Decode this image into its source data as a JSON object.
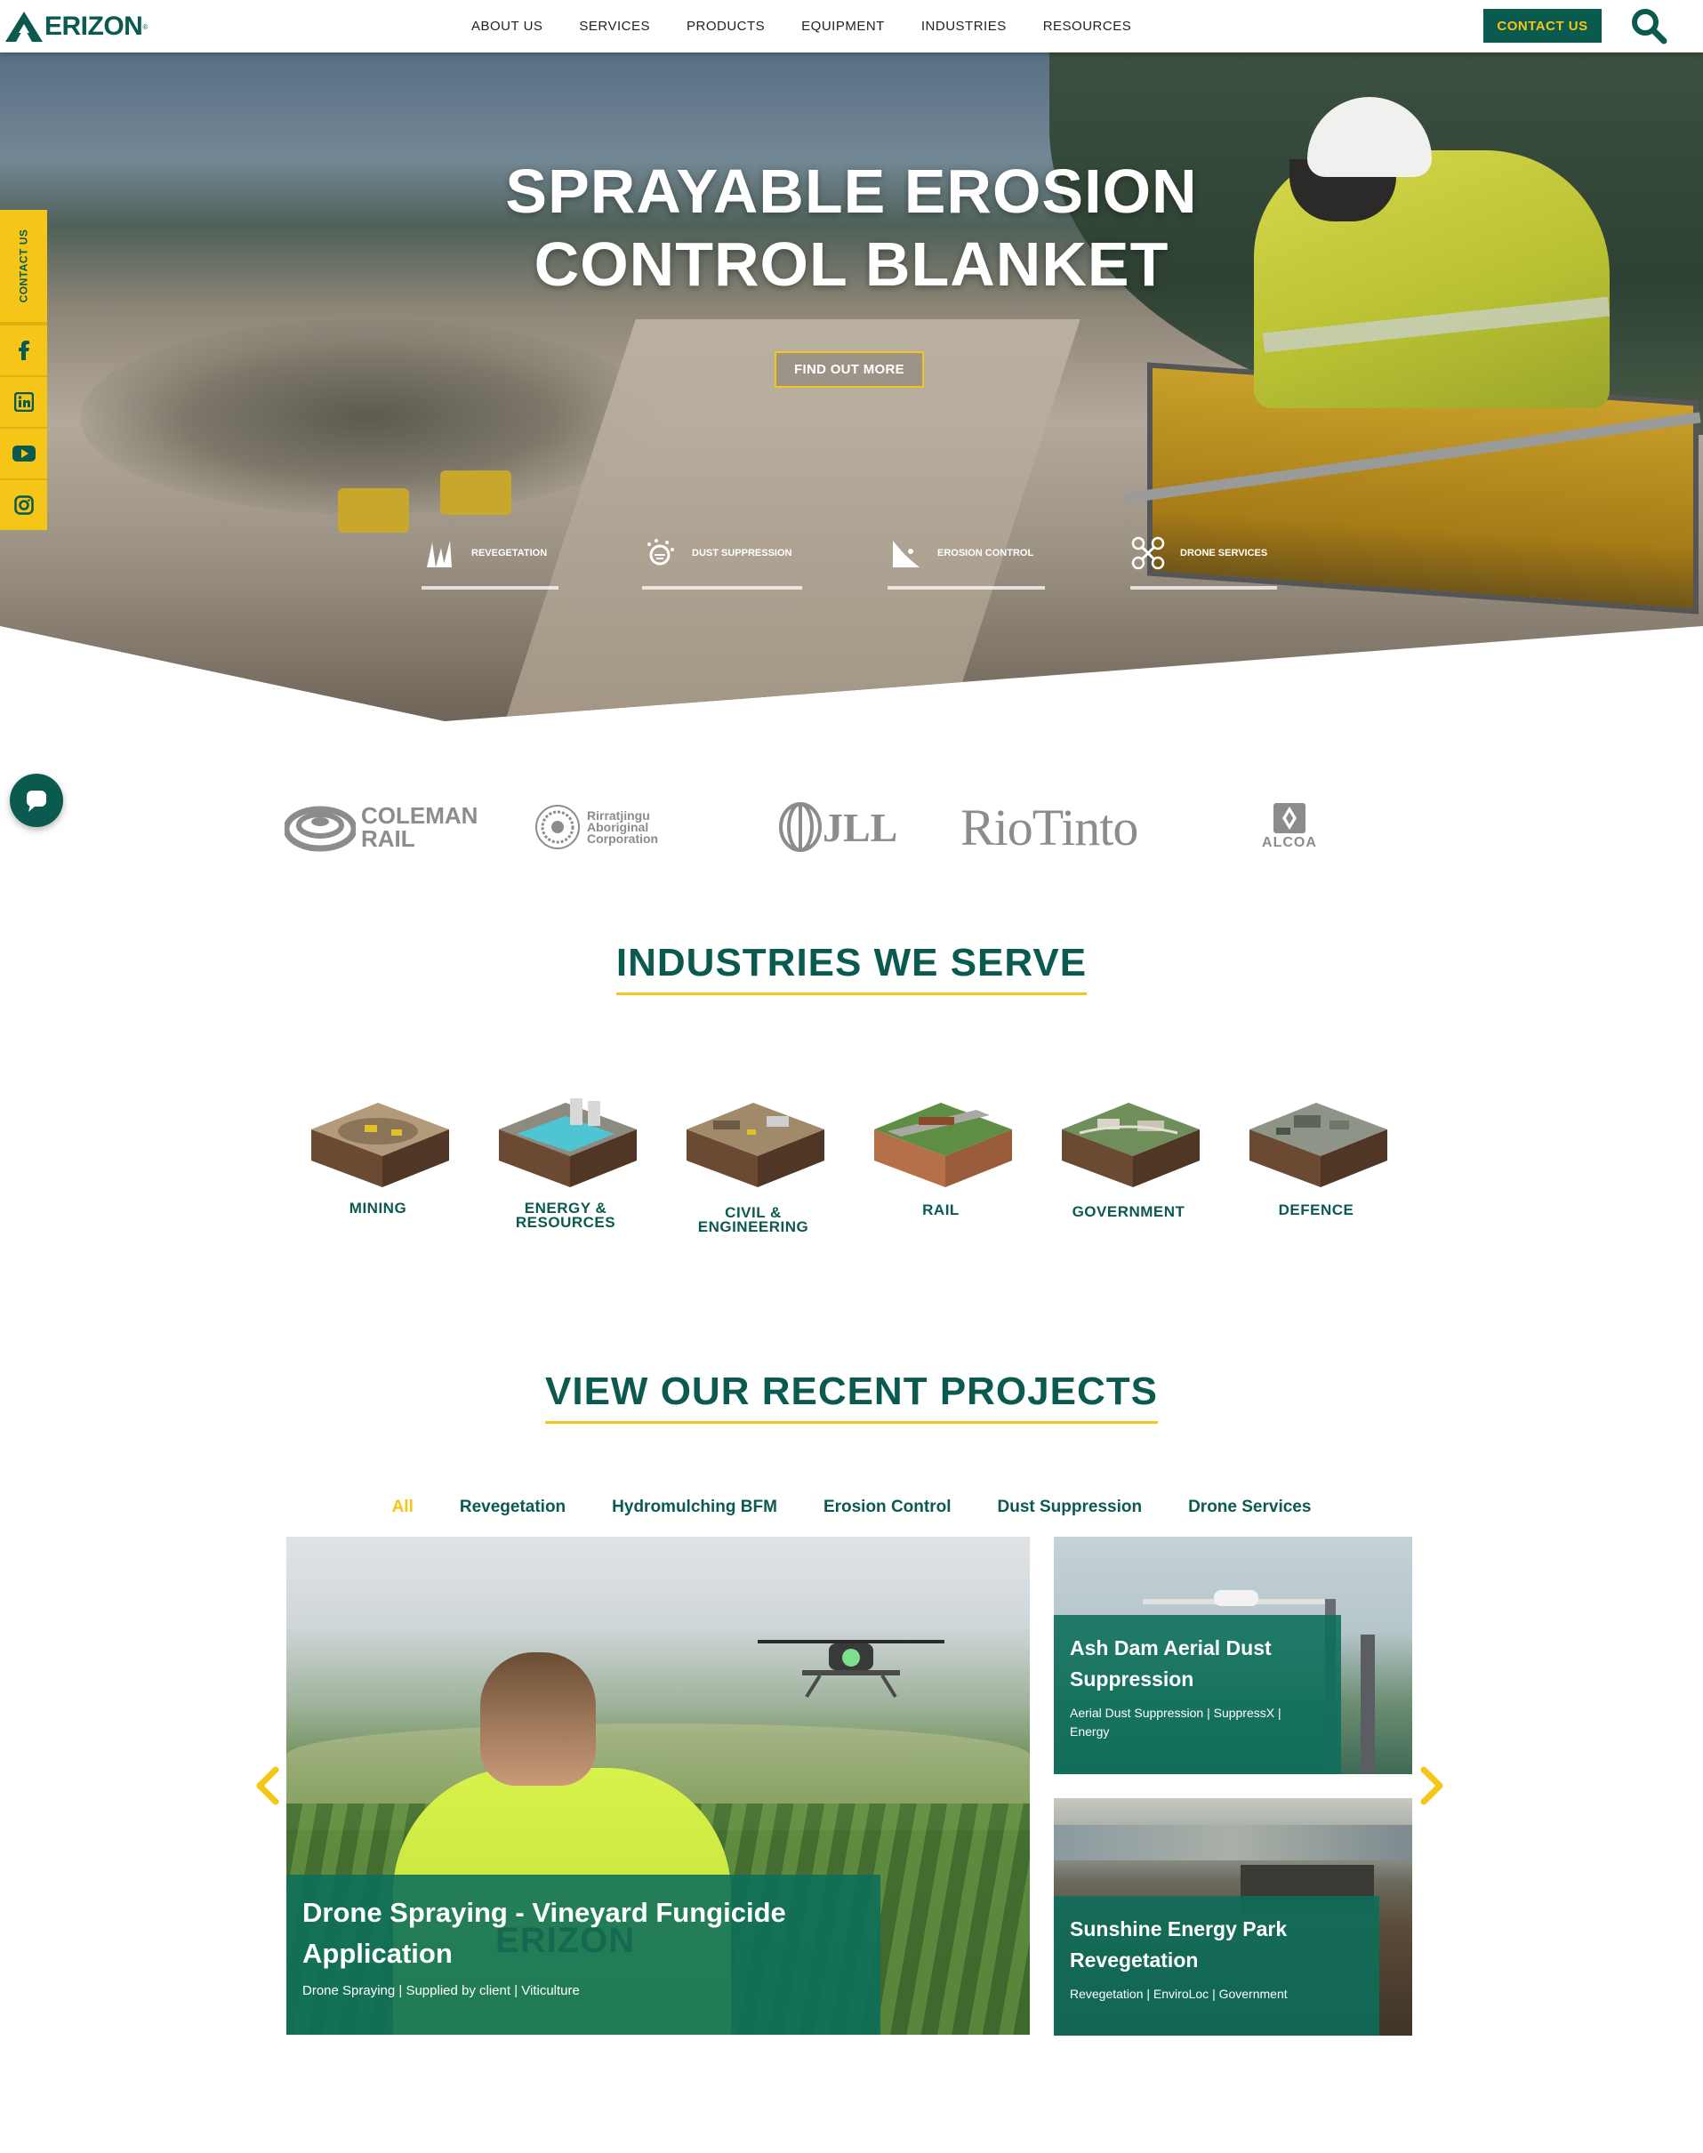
{
  "header": {
    "logo_text": "ERIZON",
    "logo_mark": "®",
    "nav": [
      "ABOUT US",
      "SERVICES",
      "PRODUCTS",
      "EQUIPMENT",
      "INDUSTRIES",
      "RESOURCES"
    ],
    "contact_label": "CONTACT US",
    "search_icon": "search-icon"
  },
  "colors": {
    "brand_green": "#0b5a4f",
    "accent_yellow": "#f5c518"
  },
  "hero": {
    "title_line1": "SPRAYABLE EROSION",
    "title_line2": "CONTROL BLANKET",
    "cta_label": "FIND OUT MORE",
    "services": [
      {
        "label": "REVEGETATION",
        "icon": "grass-icon"
      },
      {
        "label": "DUST SUPPRESSION",
        "icon": "dust-icon"
      },
      {
        "label": "EROSION CONTROL",
        "icon": "slope-icon"
      },
      {
        "label": "DRONE SERVICES",
        "icon": "drone-icon"
      }
    ]
  },
  "side_bar": {
    "contact_label": "CONTACT US",
    "icons": [
      "facebook-icon",
      "linkedin-icon",
      "youtube-icon",
      "instagram-icon"
    ]
  },
  "chat": {
    "icon": "chat-icon"
  },
  "clients": {
    "coleman_line1": "COLEMAN",
    "coleman_line2": "RAIL",
    "rirr_line1": "Rirratjingu",
    "rirr_line2": "Aboriginal",
    "rirr_line3": "Corporation",
    "jll": "JLL",
    "rio": "RioTinto",
    "alcoa": "ALCOA"
  },
  "industries": {
    "title": "INDUSTRIES WE SERVE",
    "items": [
      {
        "line1": "MINING",
        "line2": ""
      },
      {
        "line1": "ENERGY &",
        "line2": "RESOURCES"
      },
      {
        "line1": "CIVIL &",
        "line2": "ENGINEERING"
      },
      {
        "line1": "RAIL",
        "line2": ""
      },
      {
        "line1": "GOVERNMENT",
        "line2": ""
      },
      {
        "line1": "DEFENCE",
        "line2": ""
      }
    ]
  },
  "projects": {
    "title": "VIEW OUR RECENT PROJECTS",
    "filters": [
      "All",
      "Revegetation",
      "Hydromulching BFM",
      "Erosion Control",
      "Dust Suppression",
      "Drone Services"
    ],
    "active_filter": "All",
    "main": {
      "title_line1": "Drone Spraying - Vineyard Fungicide",
      "title_line2": "Application",
      "tags": "Drone Spraying | Supplied by client | Viticulture",
      "jacket_text": "ERIZON"
    },
    "side": [
      {
        "title_line1": "Ash Dam Aerial Dust",
        "title_line2": "Suppression",
        "tags_line1": "Aerial Dust Suppression | SuppressX |",
        "tags_line2": "Energy"
      },
      {
        "title_line1": "Sunshine Energy Park",
        "title_line2": "Revegetation",
        "tags_line1": "Revegetation | EnviroLoc | Government",
        "tags_line2": ""
      }
    ]
  }
}
